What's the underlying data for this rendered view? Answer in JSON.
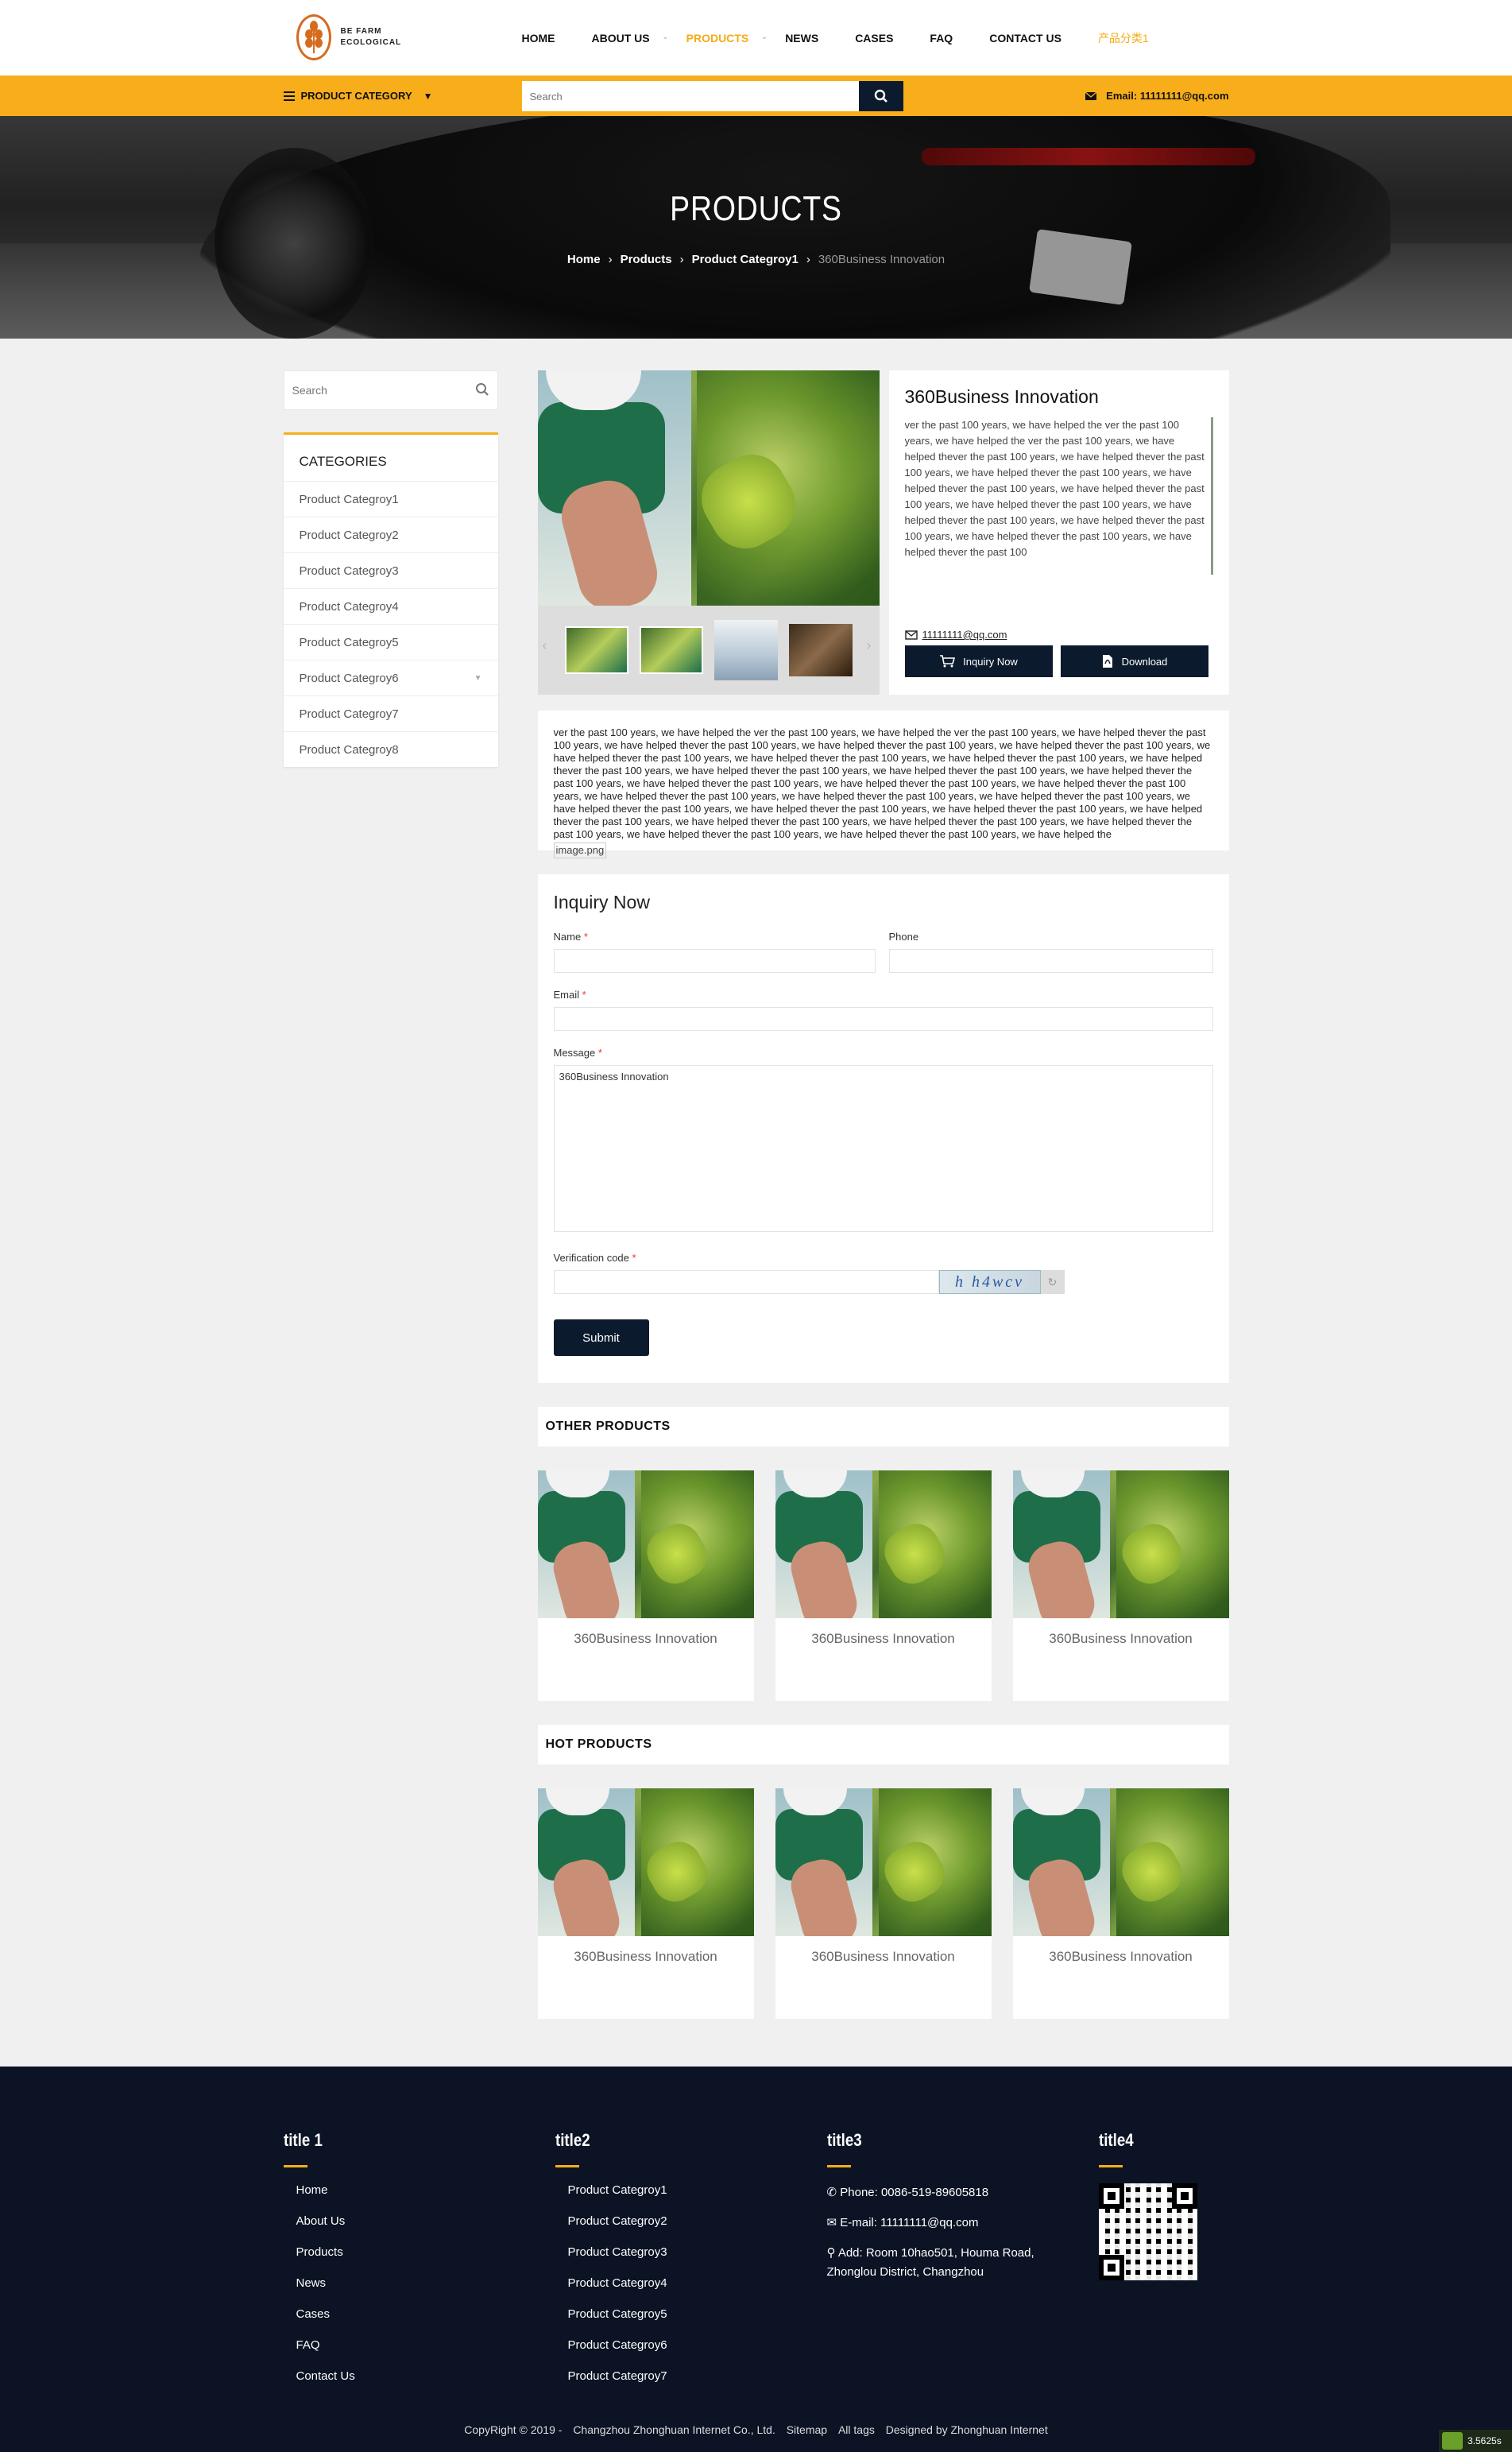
{
  "header": {
    "logo_line1": "BE FARM",
    "logo_line2": "ECOLOGICAL",
    "nav": [
      "HOME",
      "ABOUT US",
      "PRODUCTS",
      "NEWS",
      "CASES",
      "FAQ",
      "CONTACT US",
      "产品分类1"
    ],
    "product_category_label": "PRODUCT CATEGORY",
    "search_placeholder": "Search",
    "email": "Email: 11111111@qq.com"
  },
  "banner": {
    "title": "PRODUCTS",
    "breadcrumb": [
      "Home",
      "Products",
      "Product Categroy1",
      "360Business Innovation"
    ]
  },
  "sidebar": {
    "search_placeholder": "Search",
    "categories_title": "CATEGORIES",
    "categories": [
      "Product Categroy1",
      "Product Categroy2",
      "Product Categroy3",
      "Product Categroy4",
      "Product Categroy5",
      "Product Categroy6",
      "Product Categroy7",
      "Product Categroy8"
    ]
  },
  "product": {
    "title": "360Business Innovation",
    "short_desc": "ver the past 100 years, we have helped the ver the past 100 years, we have helped the ver the past 100 years, we have helped thever the past 100 years, we have helped thever the past 100 years, we have helped thever the past 100 years, we have helped thever the past 100 years, we have helped thever the past 100 years, we have helped thever the past 100 years, we have helped thever the past 100 years, we have helped thever the past 100 years, we have helped thever the past 100 years, we have helped thever the past 100",
    "email": "11111111@qq.com",
    "inquiry_btn": "Inquiry Now",
    "download_btn": "Download",
    "detail_text": "ver the past 100 years, we have helped the ver the past 100 years, we have helped the ver the past 100 years, we have helped thever the past 100 years, we have helped thever the past 100 years, we have helped thever the past 100 years, we have helped thever the past 100 years, we have helped thever the past 100 years, we have helped thever the past 100 years, we have helped thever the past 100 years, we have helped thever the past 100 years, we have helped thever the past 100 years, we have helped thever the past 100 years, we have helped thever the past 100 years, we have helped thever the past 100 years, we have helped thever the past 100 years, we have helped thever the past 100 years, we have helped thever the past 100 years, we have helped thever the past 100 years, we have helped thever the past 100 years, we have helped thever the past 100 years, we have helped thever the past 100 years, we have helped thever the past 100 years, we have helped thever the past 100 years, we have helped thever the past 100 years, we have helped thever the past 100 years, we have helped thever the past 100 years, we have helped thever the past 100 years, we have helped thever the past 100 years, we have helped the",
    "detail_image_alt": "image.png"
  },
  "inquiry": {
    "title": "Inquiry Now",
    "name_label": "Name",
    "phone_label": "Phone",
    "email_label": "Email",
    "message_label": "Message",
    "message_value": "360Business Innovation",
    "verification_label": "Verification code",
    "captcha_text": "h h4wcv",
    "submit": "Submit"
  },
  "other_products": {
    "title": "OTHER PRODUCTS",
    "items": [
      "360Business Innovation",
      "360Business Innovation",
      "360Business Innovation"
    ]
  },
  "hot_products": {
    "title": "HOT PRODUCTS",
    "items": [
      "360Business Innovation",
      "360Business Innovation",
      "360Business Innovation"
    ]
  },
  "footer": {
    "col1_title": "title 1",
    "col1_links": [
      "Home",
      "About Us",
      "Products",
      "News",
      "Cases",
      "FAQ",
      "Contact Us"
    ],
    "col2_title": "title2",
    "col2_links": [
      "Product Categroy1",
      "Product Categroy2",
      "Product Categroy3",
      "Product Categroy4",
      "Product Categroy5",
      "Product Categroy6",
      "Product Categroy7"
    ],
    "col3_title": "title3",
    "phone": "Phone: 0086-519-89605818",
    "email": "E-mail: 11111111@qq.com",
    "address": "Add: Room 10hao501, Houma Road, Zhonglou District, Changzhou",
    "col4_title": "title4",
    "copyright": "CopyRight © 2019 -",
    "company": "Changzhou Zhonghuan Internet Co., Ltd.",
    "sitemap": "Sitemap",
    "all_tags": "All tags",
    "designed_by": "Designed by Zhonghuan Internet"
  },
  "timer_badge": "3.5625s",
  "colors": {
    "accent": "#f8ae1b",
    "dark": "#0b1a2d",
    "footer_bg": "#0b1324"
  }
}
